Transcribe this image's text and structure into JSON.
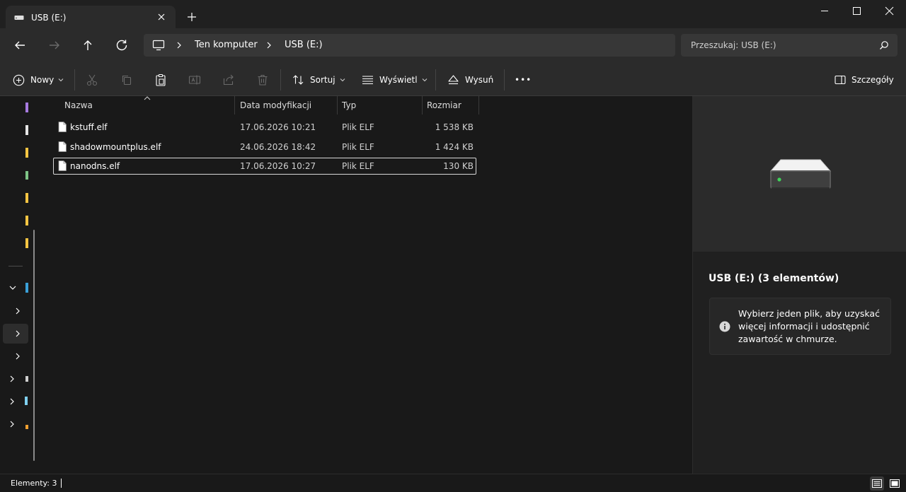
{
  "window": {
    "tab_title": "USB (E:)",
    "new_tab": "+"
  },
  "address": {
    "segments": [
      "Ten komputer",
      "USB (E:)"
    ],
    "search_placeholder": "Przeszukaj: USB (E:)"
  },
  "commands": {
    "new": "Nowy",
    "sort": "Sortuj",
    "view": "Wyświetl",
    "eject": "Wysuń",
    "more": "•••",
    "details": "Szczegóły"
  },
  "table": {
    "columns": [
      "Nazwa",
      "Data modyfikacji",
      "Typ",
      "Rozmiar"
    ],
    "rows": [
      {
        "name": "kstuff.elf",
        "date": "17.06.2026 10:21",
        "type": "Plik ELF",
        "size": "1 538 KB"
      },
      {
        "name": "shadowmountplus.elf",
        "date": "24.06.2026 18:42",
        "type": "Plik ELF",
        "size": "1 424 KB"
      },
      {
        "name": "nanodns.elf",
        "date": "17.06.2026 10:27",
        "type": "Plik ELF",
        "size": "130 KB"
      }
    ],
    "selected_row": 2
  },
  "details_pane": {
    "title": "USB (E:) (3 elementów)",
    "info": "Wybierz jeden plik, aby uzyskać więcej informacji i udostępnić zawartość w chmurze."
  },
  "status": {
    "count": "Elementy: 3"
  },
  "colors": {
    "background": "#191919",
    "toolbar": "#2b2b2b",
    "field": "#373737",
    "drive_led": "#3fd35a",
    "folder": "#f5c542"
  }
}
